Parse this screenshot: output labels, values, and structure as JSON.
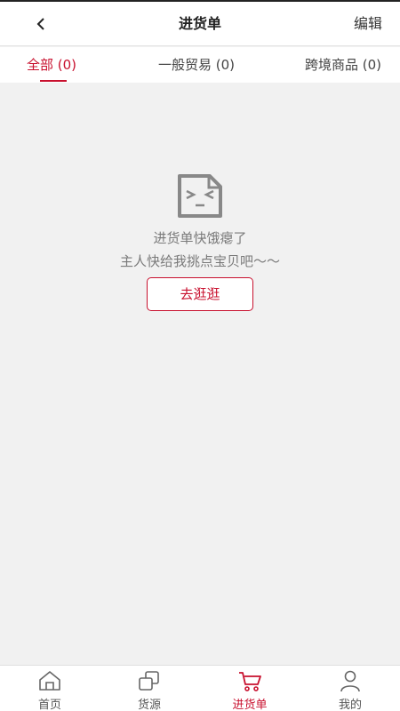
{
  "header": {
    "title": "进货单",
    "edit_label": "编辑"
  },
  "tabs": [
    {
      "label": "全部 (0)",
      "active": true
    },
    {
      "label": "一般贸易 (0)",
      "active": false
    },
    {
      "label": "跨境商品 (0)",
      "active": false
    }
  ],
  "empty": {
    "line1": "进货单快饿瘪了",
    "line2": "主人快给我挑点宝贝吧～～",
    "button_label": "去逛逛",
    "icon": "empty-file-face-icon"
  },
  "nav": [
    {
      "label": "首页",
      "icon": "home-icon",
      "active": false
    },
    {
      "label": "货源",
      "icon": "source-icon",
      "active": false
    },
    {
      "label": "进货单",
      "icon": "cart-icon",
      "active": true
    },
    {
      "label": "我的",
      "icon": "user-icon",
      "active": false
    }
  ],
  "colors": {
    "accent": "#c8102e",
    "background": "#f1f1f1",
    "text_muted": "#7a7a7a"
  }
}
